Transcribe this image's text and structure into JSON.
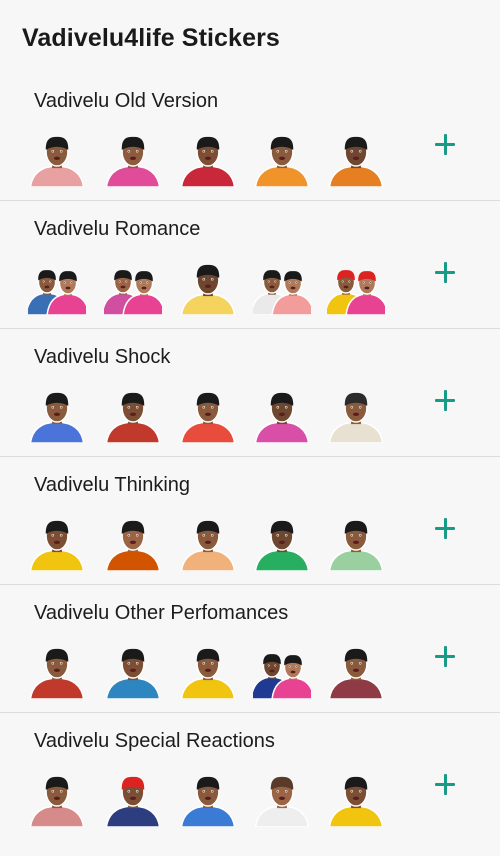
{
  "app": {
    "title": "Vadivelu4life Stickers"
  },
  "colors": {
    "accent": "#189a87",
    "background": "#f7f7f7",
    "divider": "#dcdcdc"
  },
  "packs": [
    {
      "name": "Vadivelu Old Version",
      "action_icon": "plus-icon",
      "stickers": [
        {
          "icon": "sticker-face",
          "shirt": "#e8a0a0",
          "skin": "#8a5a3c",
          "hair": "#1a1a1a"
        },
        {
          "icon": "sticker-face",
          "shirt": "#e04c9a",
          "skin": "#8d5b3e",
          "hair": "#1a1a1a"
        },
        {
          "icon": "sticker-face",
          "shirt": "#c9283a",
          "skin": "#7c4f35",
          "hair": "#1a1a1a"
        },
        {
          "icon": "sticker-face",
          "shirt": "#f0932b",
          "skin": "#8a5a3c",
          "hair": "#1a1a1a"
        },
        {
          "icon": "sticker-face",
          "shirt": "#e67e22",
          "skin": "#6f462f",
          "hair": "#1a1a1a"
        }
      ]
    },
    {
      "name": "Vadivelu Romance",
      "action_icon": "plus-icon",
      "stickers": [
        {
          "icon": "sticker-duo",
          "shirt": "#3a6fb5",
          "skin": "#8a5a3c",
          "hair": "#1a1a1a"
        },
        {
          "icon": "sticker-duo",
          "shirt": "#d04fa0",
          "skin": "#9a6445",
          "hair": "#1a1a1a"
        },
        {
          "icon": "sticker-face",
          "shirt": "#f4d35e",
          "skin": "#6f462f",
          "hair": "#1a1a1a"
        },
        {
          "icon": "sticker-duo",
          "shirt": "#eaeaea",
          "skin": "#8a5a3c",
          "hair": "#1a1a1a"
        },
        {
          "icon": "sticker-duo",
          "shirt": "#f1c40f",
          "skin": "#8a5a3c",
          "hair": "#d22"
        }
      ]
    },
    {
      "name": "Vadivelu Shock",
      "action_icon": "plus-icon",
      "stickers": [
        {
          "icon": "sticker-face",
          "shirt": "#4a74d9",
          "skin": "#8a5a3c",
          "hair": "#1a1a1a"
        },
        {
          "icon": "sticker-face",
          "shirt": "#c0392b",
          "skin": "#7c4f35",
          "hair": "#1a1a1a"
        },
        {
          "icon": "sticker-face",
          "shirt": "#e74c3c",
          "skin": "#8a5a3c",
          "hair": "#1a1a1a"
        },
        {
          "icon": "sticker-face",
          "shirt": "#d94fa8",
          "skin": "#6f462f",
          "hair": "#1a1a1a"
        },
        {
          "icon": "sticker-face",
          "shirt": "#e8e0d0",
          "skin": "#8a5a3c",
          "hair": "#2b2b2b"
        }
      ]
    },
    {
      "name": "Vadivelu Thinking",
      "action_icon": "plus-icon",
      "stickers": [
        {
          "icon": "sticker-face",
          "shirt": "#f1c40f",
          "skin": "#7c4f35",
          "hair": "#1a1a1a"
        },
        {
          "icon": "sticker-face",
          "shirt": "#d35400",
          "skin": "#9a6445",
          "hair": "#1a1a1a"
        },
        {
          "icon": "sticker-face",
          "shirt": "#f0b27a",
          "skin": "#8a5a3c",
          "hair": "#1a1a1a"
        },
        {
          "icon": "sticker-face",
          "shirt": "#27ae60",
          "skin": "#6f462f",
          "hair": "#1a1a1a"
        },
        {
          "icon": "sticker-face",
          "shirt": "#9ad0a0",
          "skin": "#8a5a3c",
          "hair": "#1a1a1a"
        }
      ]
    },
    {
      "name": "Vadivelu Other Perfomances",
      "action_icon": "plus-icon",
      "stickers": [
        {
          "icon": "sticker-face",
          "shirt": "#c0392b",
          "skin": "#8a5a3c",
          "hair": "#1a1a1a"
        },
        {
          "icon": "sticker-face",
          "shirt": "#2e86c1",
          "skin": "#7c4f35",
          "hair": "#1a1a1a"
        },
        {
          "icon": "sticker-face",
          "shirt": "#f1c40f",
          "skin": "#8a5a3c",
          "hair": "#1a1a1a"
        },
        {
          "icon": "sticker-duo",
          "shirt": "#1f3a93",
          "skin": "#6f462f",
          "hair": "#1a1a1a"
        },
        {
          "icon": "sticker-face",
          "shirt": "#8e3b46",
          "skin": "#8a5a3c",
          "hair": "#1a1a1a"
        }
      ]
    },
    {
      "name": "Vadivelu Special Reactions",
      "action_icon": "plus-icon",
      "stickers": [
        {
          "icon": "sticker-face",
          "shirt": "#d68a8a",
          "skin": "#8a5a3c",
          "hair": "#1a1a1a"
        },
        {
          "icon": "sticker-face",
          "shirt": "#2c3e80",
          "skin": "#7c4f35",
          "hair": "#d22"
        },
        {
          "icon": "sticker-face",
          "shirt": "#3a7bd5",
          "skin": "#8a5a3c",
          "hair": "#1a1a1a"
        },
        {
          "icon": "sticker-face",
          "shirt": "#eeeeee",
          "skin": "#9a6445",
          "hair": "#5a3a2a"
        },
        {
          "icon": "sticker-face",
          "shirt": "#f1c40f",
          "skin": "#7c4f35",
          "hair": "#1a1a1a"
        }
      ]
    }
  ]
}
